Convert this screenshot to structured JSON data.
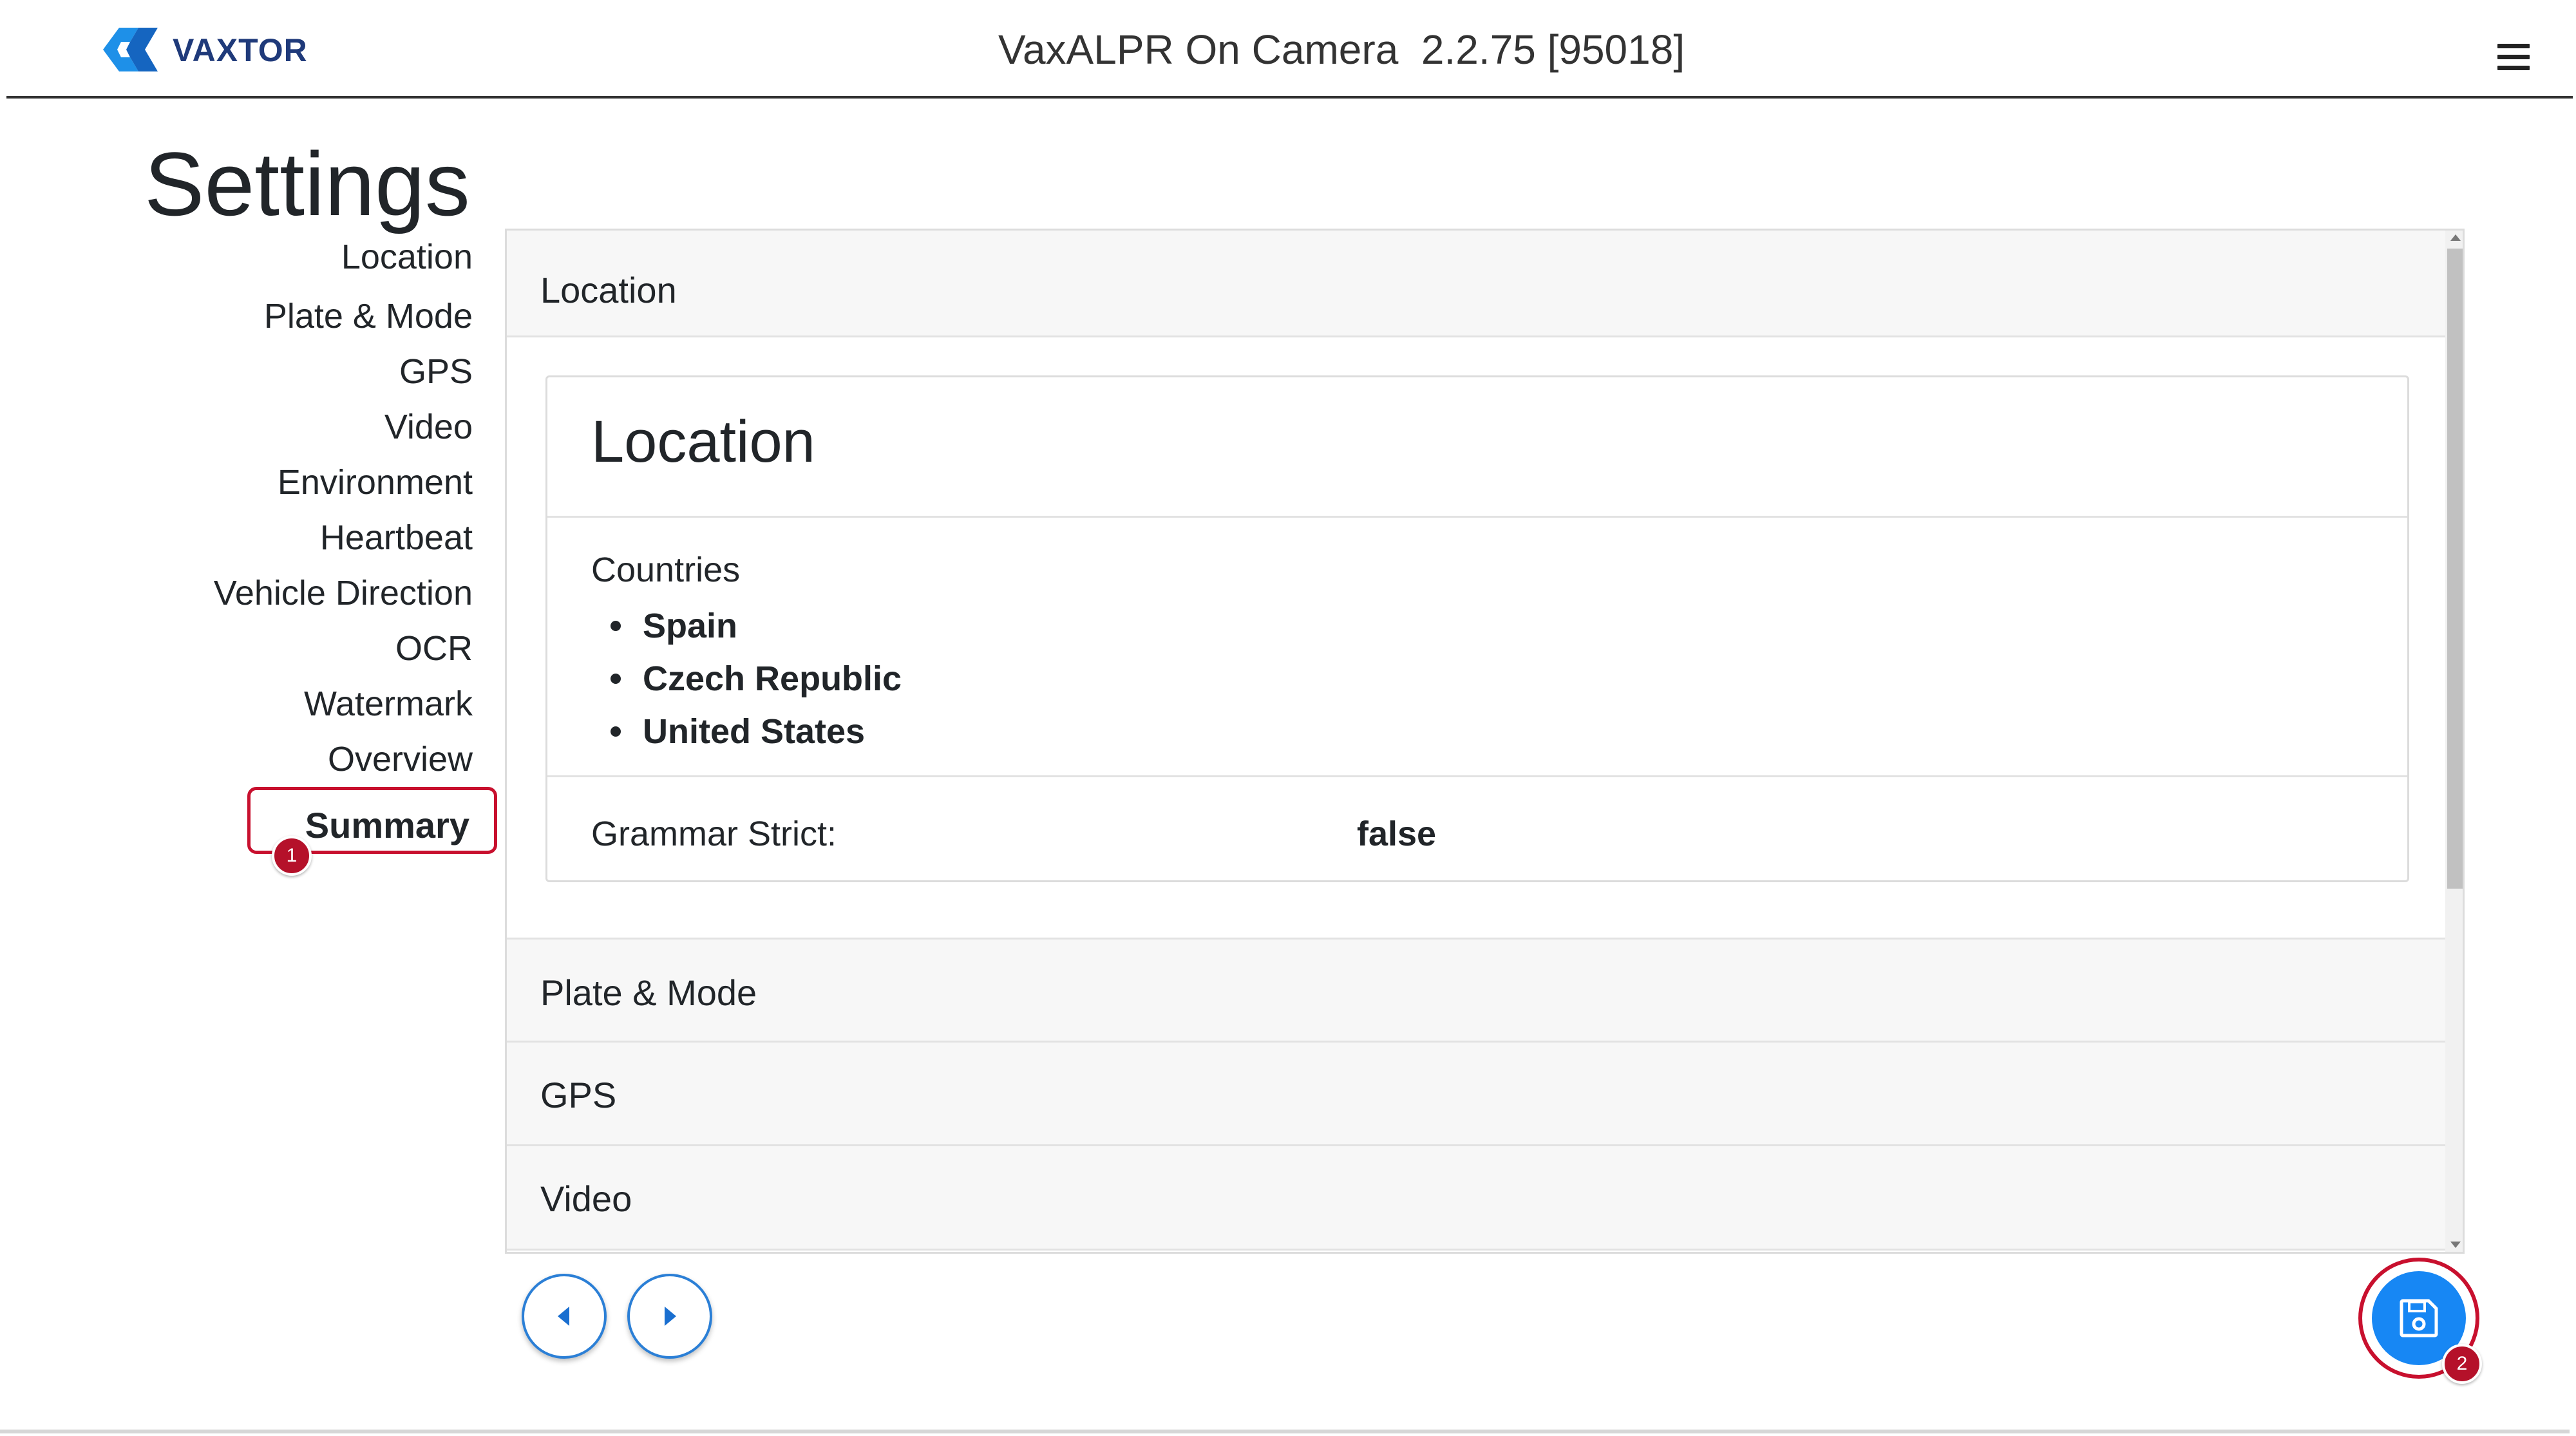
{
  "brand": {
    "name": "VAXTOR"
  },
  "header": {
    "title": "VaxALPR On Camera  2.2.75 [95018]"
  },
  "page": {
    "title": "Settings"
  },
  "sidebar": {
    "items": [
      {
        "label": "Location"
      },
      {
        "label": "Plate & Mode"
      },
      {
        "label": "GPS"
      },
      {
        "label": "Video"
      },
      {
        "label": "Environment"
      },
      {
        "label": "Heartbeat"
      },
      {
        "label": "Vehicle Direction"
      },
      {
        "label": "OCR"
      },
      {
        "label": "Watermark"
      },
      {
        "label": "Overview"
      },
      {
        "label": "Summary",
        "active": true
      }
    ]
  },
  "annotations": {
    "badge1": "1",
    "badge2": "2"
  },
  "panel": {
    "location_header": "Location",
    "card": {
      "title": "Location",
      "countries_label": "Countries",
      "countries": [
        "Spain",
        "Czech Republic",
        "United States"
      ],
      "grammar_label": "Grammar Strict:",
      "grammar_value": "false"
    },
    "sections": [
      "Plate & Mode",
      "GPS",
      "Video"
    ]
  },
  "icons": {
    "logo": "vaxtor-logo-icon",
    "menu": "hamburger-menu-icon",
    "prev": "caret-left-icon",
    "next": "caret-right-icon",
    "save": "floppy-disk-icon"
  },
  "colors": {
    "accent": "#1787f4",
    "highlight": "#c8102e",
    "brand": "#1f3a7a"
  }
}
